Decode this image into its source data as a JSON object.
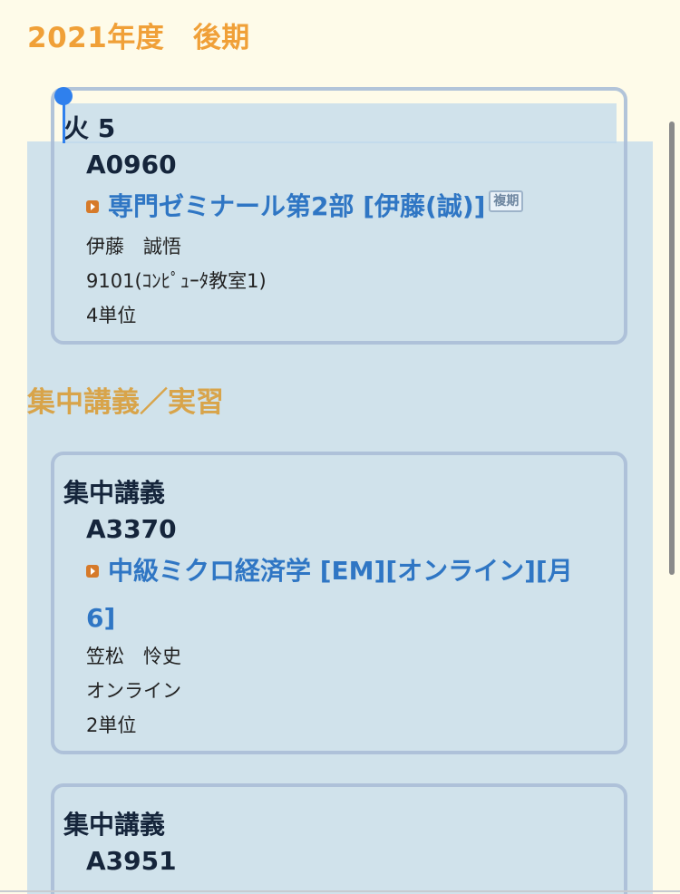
{
  "header": {
    "term": "2021年度　後期"
  },
  "regular": {
    "slot": "火 5",
    "code": "A0960",
    "course": "専門ゼミナール第2部 [伊藤(誠)]",
    "tag": "複期",
    "teacher": "伊藤　誠悟",
    "room": "9101(ｺﾝﾋﾟｭｰﾀ教室1)",
    "credits": "4単位"
  },
  "intensive": {
    "section_title": "集中講義／実習",
    "items": [
      {
        "slot": "集中講義",
        "code": "A3370",
        "course": "中級ミクロ経済学 [EM][オンライン][月6]",
        "teacher": "笠松　怜史",
        "room": "オンライン",
        "credits": "2単位"
      },
      {
        "slot": "集中講義",
        "code": "A3951"
      }
    ]
  },
  "colors": {
    "title": "#f0a038",
    "section": "#d8a44a",
    "link": "#2f76c4",
    "selection": "#bed8ec",
    "caret": "#2f80ed"
  }
}
